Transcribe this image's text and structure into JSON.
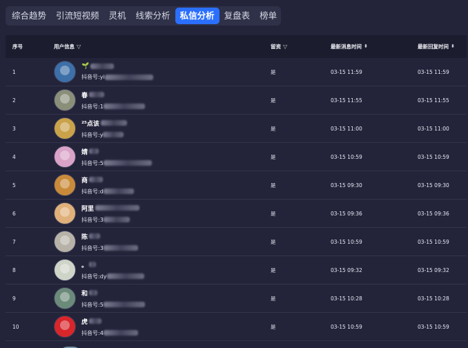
{
  "tabs": [
    {
      "label": "综合趋势",
      "active": false
    },
    {
      "label": "引流短视频",
      "active": false
    },
    {
      "label": "灵机",
      "active": false
    },
    {
      "label": "线索分析",
      "active": false
    },
    {
      "label": "私信分析",
      "active": true
    },
    {
      "label": "复盘表",
      "active": false
    },
    {
      "label": "榜单",
      "active": false
    }
  ],
  "table": {
    "headers": {
      "index": "序号",
      "user_info": "用户信息",
      "retained": "留资",
      "latest_msg_time": "最新消息时间",
      "latest_reply_time": "最新回复时间"
    },
    "id_prefix": "抖音号:",
    "rows": [
      {
        "index": "1",
        "name": "🌱",
        "id": "yi",
        "retained": "是",
        "msg_time": "03-15 11:59",
        "reply_time": "03-15 11:59",
        "avatar_color": "#3d6fa8"
      },
      {
        "index": "2",
        "name": "春",
        "id": "1",
        "retained": "是",
        "msg_time": "03-15 11:55",
        "reply_time": "03-15 11:55",
        "avatar_color": "#8a8f7a"
      },
      {
        "index": "3",
        "name": "²⁵点该",
        "id": "y",
        "retained": "是",
        "msg_time": "03-15 11:00",
        "reply_time": "03-15 11:00",
        "avatar_color": "#c9a24a"
      },
      {
        "index": "4",
        "name": "婧",
        "id": "5",
        "retained": "是",
        "msg_time": "03-15 10:59",
        "reply_time": "03-15 10:59",
        "avatar_color": "#d9a3c8"
      },
      {
        "index": "5",
        "name": "商",
        "id": "d",
        "retained": "是",
        "msg_time": "03-15 09:30",
        "reply_time": "03-15 09:30",
        "avatar_color": "#c98a3a"
      },
      {
        "index": "6",
        "name": "阿里",
        "id": "3",
        "retained": "是",
        "msg_time": "03-15 09:36",
        "reply_time": "03-15 09:36",
        "avatar_color": "#e0b07a"
      },
      {
        "index": "7",
        "name": "陈",
        "id": "3",
        "retained": "是",
        "msg_time": "03-15 10:59",
        "reply_time": "03-15 10:59",
        "avatar_color": "#b7b2a8"
      },
      {
        "index": "8",
        "name": "。",
        "id": "dy",
        "retained": "是",
        "msg_time": "03-15 09:32",
        "reply_time": "03-15 09:32",
        "avatar_color": "#cfd4c8"
      },
      {
        "index": "9",
        "name": "和",
        "id": "5",
        "retained": "是",
        "msg_time": "03-15 10:28",
        "reply_time": "03-15 10:28",
        "avatar_color": "#6c8a7a"
      },
      {
        "index": "10",
        "name": "虎",
        "id": "4",
        "retained": "是",
        "msg_time": "03-15 10:59",
        "reply_time": "03-15 10:59",
        "avatar_color": "#d8262b"
      }
    ]
  }
}
